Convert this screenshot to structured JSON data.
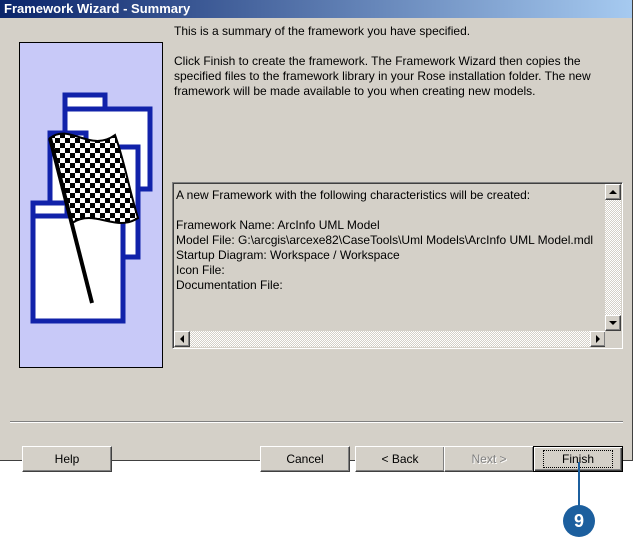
{
  "window": {
    "title": "Framework Wizard - Summary"
  },
  "intro": {
    "line1": "This is a summary of the framework you have specified.",
    "line2": "Click Finish to create the framework. The Framework Wizard then copies the specified files to the framework library in your Rose installation folder. The new framework will be made available to you when creating new models."
  },
  "summary": {
    "header": "A new Framework with the following characteristics will be created:",
    "lines": [
      "Framework Name: ArcInfo UML Model",
      "Model File: G:\\arcgis\\arcexe82\\CaseTools\\Uml Models\\ArcInfo UML Model.mdl",
      "Startup Diagram: Workspace / Workspace",
      "Icon File:",
      "Documentation File:"
    ]
  },
  "buttons": {
    "help": "Help",
    "cancel": "Cancel",
    "back": "< Back",
    "next": "Next >",
    "finish": "Finish"
  },
  "callout": {
    "number": "9"
  },
  "colors": {
    "dialog_bg": "#d4d0c8",
    "title_start": "#0a246a",
    "title_end": "#a6caf0",
    "art_bg": "#c8c9f8",
    "art_blue": "#1122aa",
    "callout": "#1c5f9e"
  },
  "icons": [
    "checkered-flag-icon",
    "folder-icon",
    "scroll-up-icon",
    "scroll-down-icon",
    "scroll-left-icon",
    "scroll-right-icon"
  ]
}
